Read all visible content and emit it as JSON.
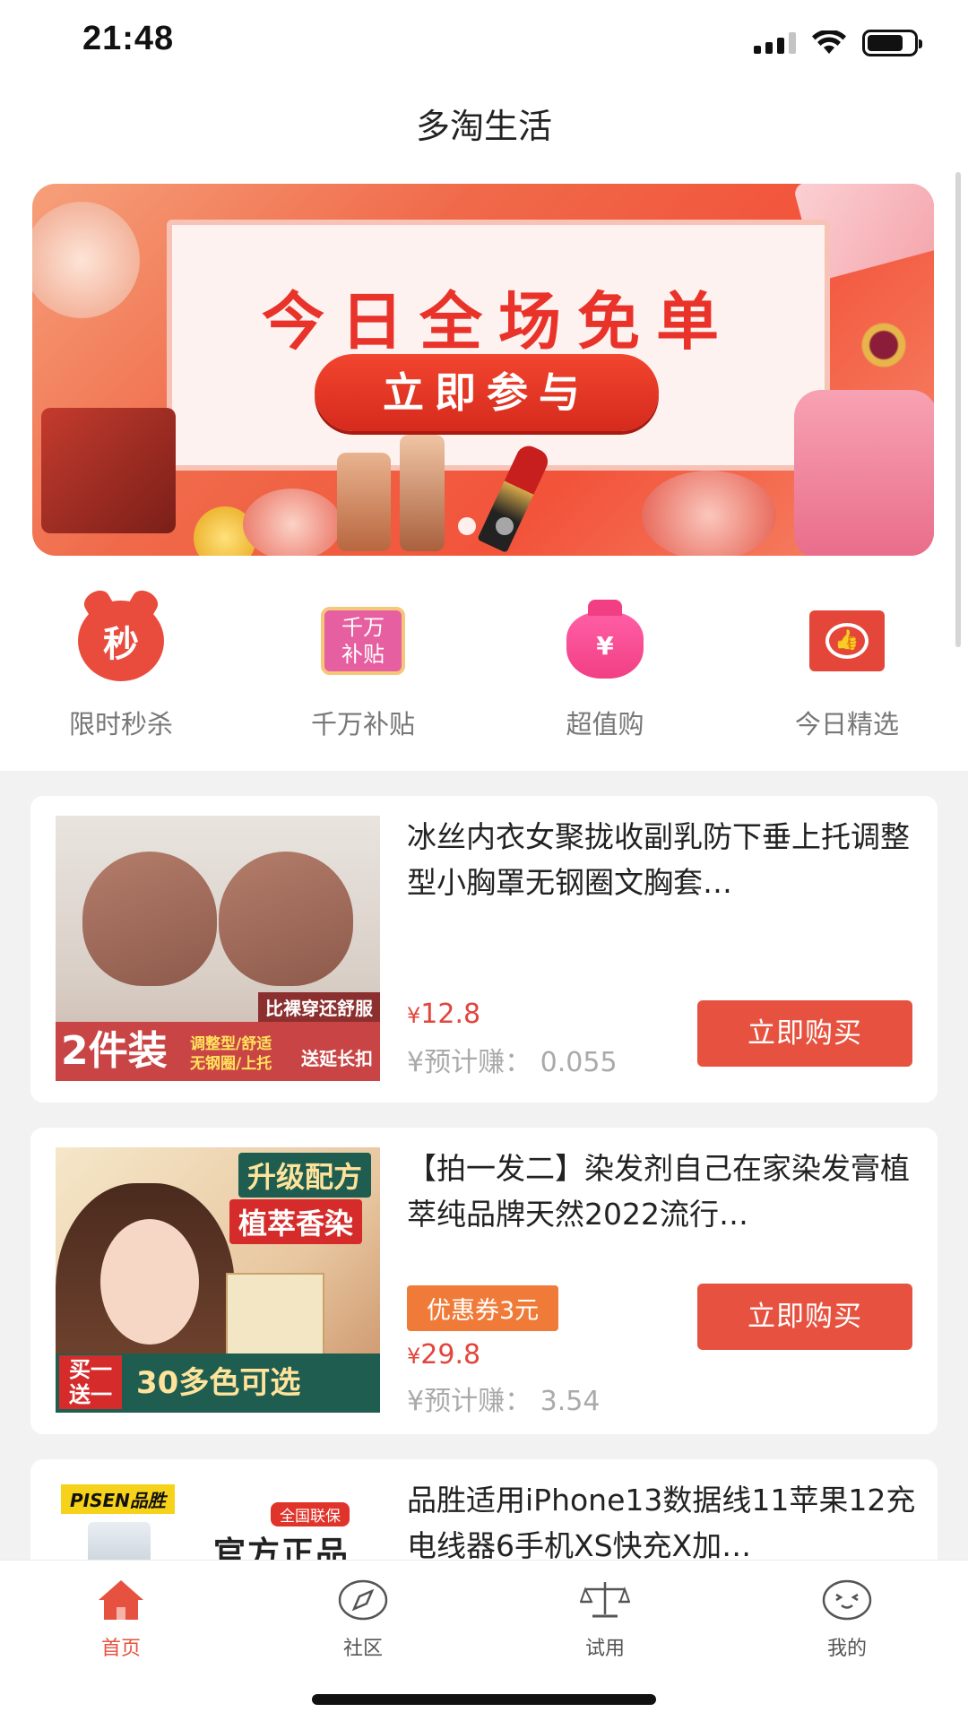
{
  "status_bar": {
    "time": "21:48",
    "icons": [
      "signal-icon",
      "wifi-icon",
      "battery-icon"
    ]
  },
  "nav": {
    "title": "多淘生活"
  },
  "banner": {
    "headline": "今日全场免单",
    "cta": "立即参与",
    "page_count": 2,
    "active_index": 1
  },
  "categories": [
    {
      "label": "限时秒杀",
      "icon": "alarm-seckill-icon",
      "icon_text": "秒"
    },
    {
      "label": "千万补贴",
      "icon": "subsidy-icon",
      "icon_text": "千万补贴"
    },
    {
      "label": "超值购",
      "icon": "money-bag-icon",
      "icon_text": "¥"
    },
    {
      "label": "今日精选",
      "icon": "thumbs-up-icon"
    }
  ],
  "products": [
    {
      "title": "冰丝内衣女聚拢收副乳防下垂上托调整型小胸罩无钢圈文胸套…",
      "image_text": {
        "badge_top": "比裸穿还舒服",
        "big": "2件装",
        "small": "调整型/舒适 无钢圈/上托",
        "right": "送延长扣"
      },
      "price_symbol": "¥",
      "price": "12.8",
      "earn_label": "¥预计赚：",
      "earn_value": "0.055",
      "buy_label": "立即购买"
    },
    {
      "title": "【拍一发二】染发剂自己在家染发膏植萃纯品牌天然2022流行…",
      "image_text": {
        "header1": "升级配方",
        "header2": "植萃香染",
        "foot_left": "买一送一",
        "foot_right": "30多色可选"
      },
      "coupon": "优惠券3元",
      "price_symbol": "¥",
      "price": "29.8",
      "earn_label": "¥预计赚：",
      "earn_value": "3.54",
      "buy_label": "立即购买"
    },
    {
      "title": "品胜适用iPhone13数据线11苹果12充电线器6手机XS快充X加…",
      "image_text": {
        "brand": "PISEN品胜",
        "badge": "全国联保",
        "official": "官方正品"
      }
    }
  ],
  "tabbar": [
    {
      "label": "首页",
      "icon": "home-icon",
      "active": true
    },
    {
      "label": "社区",
      "icon": "compass-icon",
      "active": false
    },
    {
      "label": "试用",
      "icon": "scale-icon",
      "active": false
    },
    {
      "label": "我的",
      "icon": "smiley-face-icon",
      "active": false
    }
  ],
  "colors": {
    "accent": "#e6523f",
    "price": "#e2453c",
    "coupon": "#f07b38",
    "feed_bg": "#f2f2f2"
  }
}
